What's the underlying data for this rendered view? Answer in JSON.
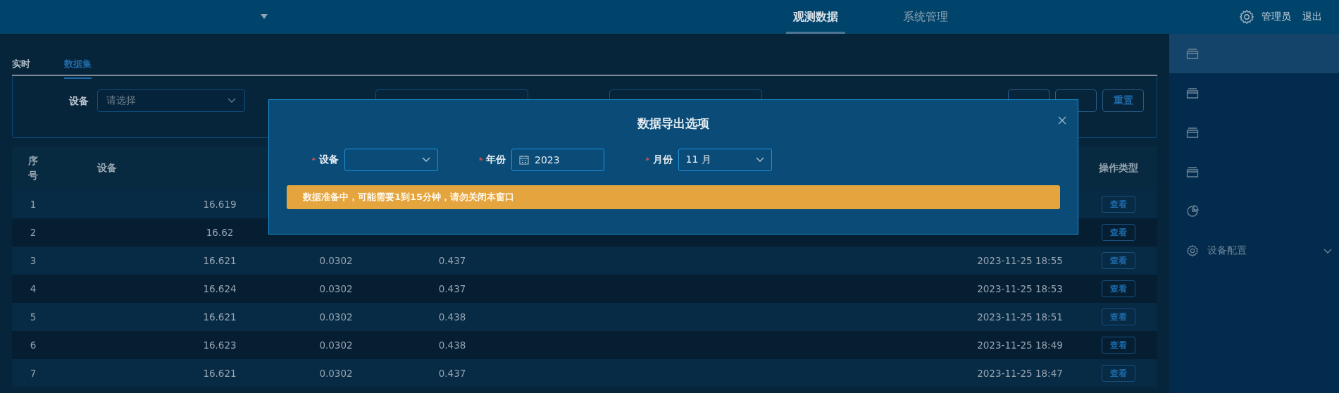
{
  "header": {
    "nav": [
      {
        "label": "观测数据",
        "selected": true
      },
      {
        "label": "系统管理",
        "selected": false
      }
    ],
    "user": "管理员",
    "logout": "退出"
  },
  "tabs": [
    {
      "label": "实时",
      "selected": false
    },
    {
      "label": "数据集",
      "selected": true
    }
  ],
  "filter": {
    "device_label": "设备",
    "device_placeholder": "请选择",
    "buttons": [
      {
        "label": "重置"
      }
    ]
  },
  "table": {
    "columns": {
      "index": "序号",
      "device": "设备",
      "action": "操作类型"
    },
    "rows": [
      {
        "index": "1",
        "temperature": "16.619",
        "action": "查看"
      },
      {
        "index": "2",
        "temperature": "16.62",
        "action": "查看"
      },
      {
        "index": "3",
        "temperature": "16.621",
        "column_4": "0.0302",
        "column_5": "0.437",
        "time": "2023-11-25 18:55",
        "action": "查看"
      },
      {
        "index": "4",
        "temperature": "16.624",
        "column_4": "0.0302",
        "column_5": "0.437",
        "time": "2023-11-25 18:53",
        "action": "查看"
      },
      {
        "index": "5",
        "temperature": "16.621",
        "column_4": "0.0302",
        "column_5": "0.438",
        "time": "2023-11-25 18:51",
        "action": "查看"
      },
      {
        "index": "6",
        "temperature": "16.623",
        "column_4": "0.0302",
        "column_5": "0.438",
        "time": "2023-11-25 18:49",
        "action": "查看"
      },
      {
        "index": "7",
        "temperature": "16.621",
        "column_4": "0.0302",
        "column_5": "0.437",
        "time": "2023-11-25 18:47",
        "action": "查看"
      }
    ]
  },
  "sidebar": {
    "items": [
      {
        "kind": "stack",
        "selected": true
      },
      {
        "kind": "stack",
        "selected": false
      },
      {
        "kind": "stack",
        "selected": false
      },
      {
        "kind": "stack",
        "selected": false
      },
      {
        "kind": "pie",
        "selected": false
      },
      {
        "kind": "gear",
        "label": "设备配置",
        "selected": false,
        "expandable": true
      }
    ]
  },
  "dialog": {
    "title": "数据导出选项",
    "fields": [
      {
        "kind": "select",
        "label": "设备",
        "required_mark": "*"
      },
      {
        "kind": "date",
        "label": "年份",
        "required_mark": "*",
        "value": "2023"
      },
      {
        "kind": "select",
        "label": "月份",
        "required_mark": "*",
        "value": "11 月"
      }
    ],
    "alert": "数据准备中，可能需要1到15分钟，请勿关闭本窗口"
  }
}
